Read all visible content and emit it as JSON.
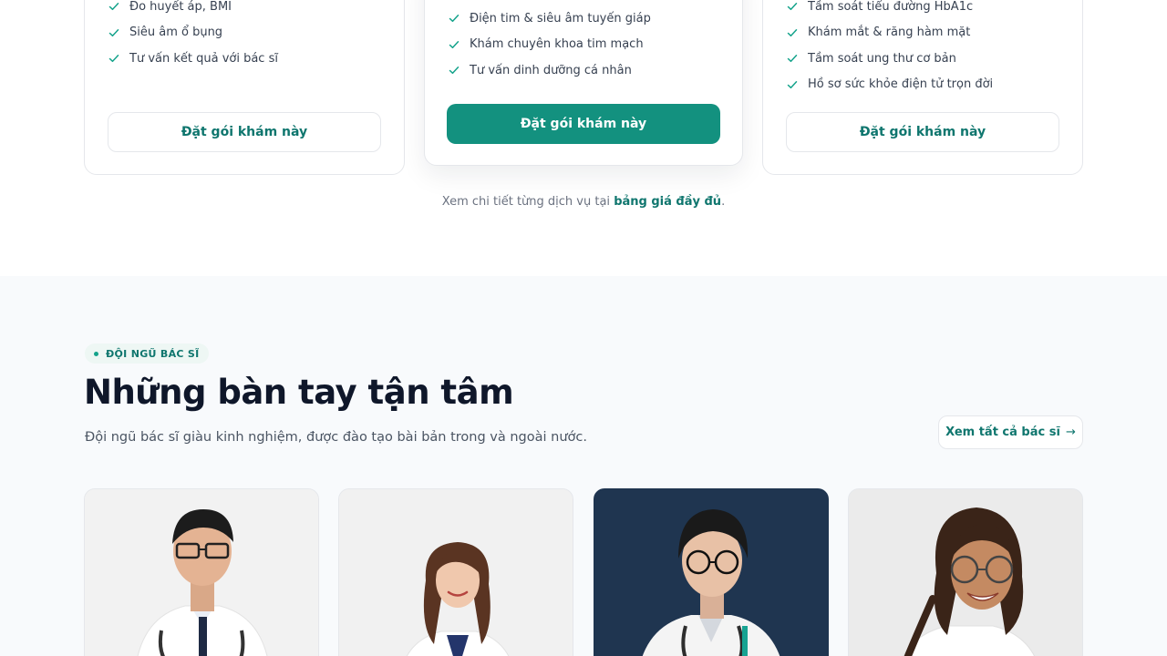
{
  "packages": {
    "left": {
      "features": [
        "Đo huyết áp, BMI",
        "Siêu âm ổ bụng",
        "Tư vấn kết quả với bác sĩ"
      ],
      "button_label": "Đặt gói khám này"
    },
    "middle": {
      "features": [
        "Điện tim & siêu âm tuyến giáp",
        "Khám chuyên khoa tim mạch",
        "Tư vấn dinh dưỡng cá nhân"
      ],
      "button_label": "Đặt gói khám này"
    },
    "right": {
      "features": [
        "Tầm soát tiểu đường HbA1c",
        "Khám mắt & răng hàm mặt",
        "Tầm soát ung thư cơ bản",
        "Hồ sơ sức khỏe điện tử trọn đời"
      ],
      "button_label": "Đặt gói khám này"
    },
    "note_prefix": "Xem chi tiết từng dịch vụ tại ",
    "note_link": "bảng giá đầy đủ",
    "note_suffix": "."
  },
  "doctors": {
    "eyebrow": "ĐỘI NGŨ BÁC SĨ",
    "title": "Những bàn tay tận tâm",
    "subtitle": "Đội ngũ bác sĩ giàu kinh nghiệm, được đào tạo bài bản trong và ngoài nước.",
    "see_all_label": "Xem tất cả bác sĩ",
    "see_all_icon": "arrow-right-icon"
  },
  "colors": {
    "accent": "#13917f",
    "accent_text": "#0f766e",
    "heading": "#0f172a",
    "section_bg": "#f8fafc"
  }
}
